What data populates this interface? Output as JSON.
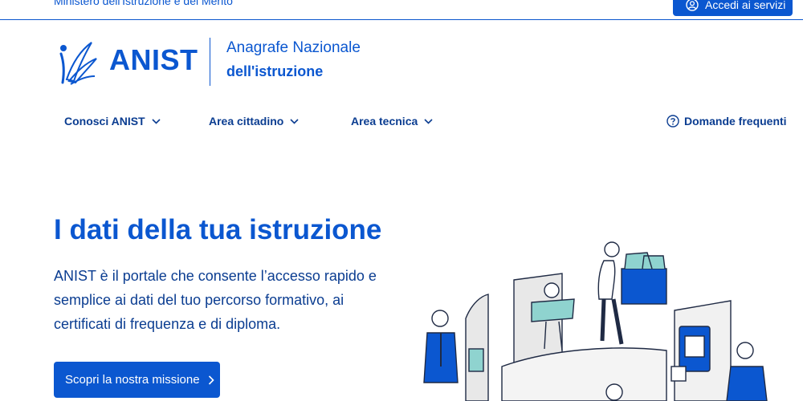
{
  "topbar": {
    "ministry": "Ministero dell'Istruzione e del Merito",
    "login_label": "Accedi ai servizi"
  },
  "header": {
    "logo_text": "ANIST",
    "subtitle_line1": "Anagrafe Nazionale",
    "subtitle_line2": "dell'istruzione"
  },
  "nav": {
    "items": [
      {
        "label": "Conosci ANIST"
      },
      {
        "label": "Area cittadino"
      },
      {
        "label": "Area tecnica"
      }
    ],
    "faq_label": "Domande frequenti"
  },
  "hero": {
    "title": "I dati della tua istruzione",
    "description": "ANIST è il portale che consente l’accesso rapido e semplice ai dati del tuo percorso formativo, ai certificati di frequenza e di diploma.",
    "cta_label": "Scopri la nostra missione"
  },
  "colors": {
    "primary": "#0b57d0",
    "text_dark": "#0b3d91",
    "illustration_teal": "#8fd3cf"
  },
  "icons": [
    "user-circle-icon",
    "chevron-down-icon",
    "question-circle-icon",
    "chevron-right-icon",
    "anist-logo-icon"
  ]
}
